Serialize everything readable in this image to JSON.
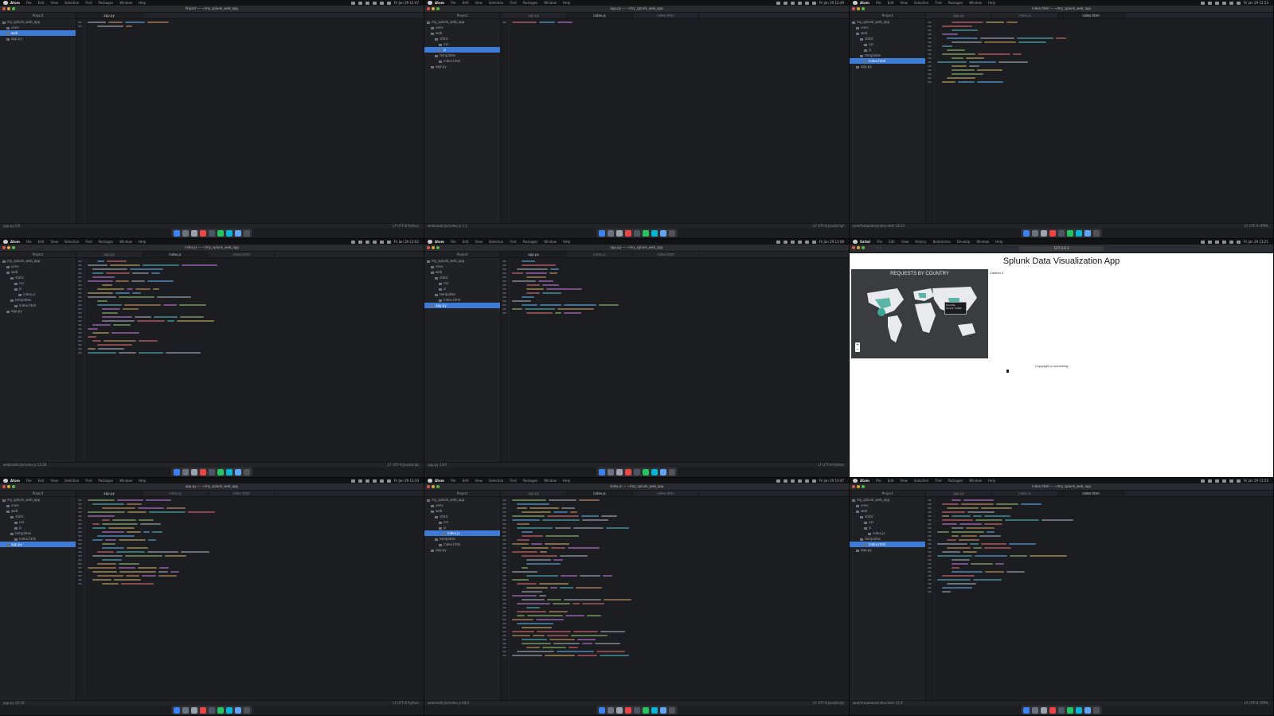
{
  "cells": [
    {
      "id": "atom-1",
      "type": "editor",
      "window_title": "Project — ~/my_splunk_web_app",
      "tabs": [
        "app.py"
      ],
      "active_tab": 0,
      "tree_head": "Project",
      "tree": [
        {
          "label": "my_splunk_web_app",
          "indent": 0
        },
        {
          "label": "venv",
          "indent": 1
        },
        {
          "label": "web",
          "indent": 1,
          "selected": true
        },
        {
          "label": "app.py",
          "indent": 1
        }
      ],
      "code_lines": 2,
      "status_left": "app.py 2:6",
      "status_right": "LF UTF-8 Python",
      "menu": [
        "Atom",
        "File",
        "Edit",
        "View",
        "Selection",
        "Find",
        "Packages",
        "Window",
        "Help"
      ],
      "clock": "Fri Jan 29 12:47"
    },
    {
      "id": "atom-2",
      "type": "editor",
      "window_title": "app.py — ~/my_splunk_web_app",
      "tabs": [
        "app.py",
        "index.js",
        "index.html"
      ],
      "active_tab": 1,
      "tree_head": "Project",
      "tree": [
        {
          "label": "my_splunk_web_app",
          "indent": 0
        },
        {
          "label": "venv",
          "indent": 1
        },
        {
          "label": "web",
          "indent": 1
        },
        {
          "label": "static",
          "indent": 2
        },
        {
          "label": "css",
          "indent": 3
        },
        {
          "label": "js",
          "indent": 3,
          "selected": true
        },
        {
          "label": "templates",
          "indent": 2
        },
        {
          "label": "index.html",
          "indent": 3
        },
        {
          "label": "app.py",
          "indent": 1
        }
      ],
      "code_lines": 1,
      "status_left": "web/static/js/index.js 1:1",
      "status_right": "LF UTF-8 JavaScript",
      "menu": [
        "Atom",
        "File",
        "Edit",
        "View",
        "Selection",
        "Find",
        "Packages",
        "Window",
        "Help"
      ],
      "clock": "Fri Jan 29 12:49"
    },
    {
      "id": "atom-3",
      "type": "editor",
      "window_title": "index.html — ~/my_splunk_web_app",
      "tabs": [
        "app.py",
        "index.js",
        "index.html"
      ],
      "active_tab": 2,
      "tree_head": "Project",
      "tree": [
        {
          "label": "my_splunk_web_app",
          "indent": 0
        },
        {
          "label": "venv",
          "indent": 1
        },
        {
          "label": "web",
          "indent": 1
        },
        {
          "label": "static",
          "indent": 2
        },
        {
          "label": "css",
          "indent": 3
        },
        {
          "label": "js",
          "indent": 3
        },
        {
          "label": "templates",
          "indent": 2
        },
        {
          "label": "index.html",
          "indent": 3,
          "selected": true
        },
        {
          "label": "app.py",
          "indent": 1
        }
      ],
      "code_lines": 16,
      "status_left": "web/templates/index.html 14:22",
      "status_right": "LF UTF-8 HTML",
      "menu": [
        "Atom",
        "File",
        "Edit",
        "View",
        "Selection",
        "Find",
        "Packages",
        "Window",
        "Help"
      ],
      "clock": "Fri Jan 29 12:53"
    },
    {
      "id": "atom-4",
      "type": "editor",
      "window_title": "index.js — ~/my_splunk_web_app",
      "tabs": [
        "app.py",
        "index.js",
        "index.html"
      ],
      "active_tab": 1,
      "tree_head": "Project",
      "tree": [
        {
          "label": "my_splunk_web_app",
          "indent": 0
        },
        {
          "label": "venv",
          "indent": 1
        },
        {
          "label": "web",
          "indent": 1
        },
        {
          "label": "static",
          "indent": 2
        },
        {
          "label": "css",
          "indent": 3
        },
        {
          "label": "js",
          "indent": 3
        },
        {
          "label": "index.js",
          "indent": 4
        },
        {
          "label": "templates",
          "indent": 2
        },
        {
          "label": "index.html",
          "indent": 3
        },
        {
          "label": "app.py",
          "indent": 1
        }
      ],
      "code_lines": 24,
      "status_left": "web/static/js/index.js 12:24",
      "status_right": "LF UTF-8 JavaScript",
      "menu": [
        "Atom",
        "File",
        "Edit",
        "View",
        "Selection",
        "Find",
        "Packages",
        "Window",
        "Help"
      ],
      "clock": "Fri Jan 29 13:02"
    },
    {
      "id": "atom-5",
      "type": "editor",
      "window_title": "app.py — ~/my_splunk_web_app",
      "tabs": [
        "app.py",
        "index.js",
        "index.html"
      ],
      "active_tab": 0,
      "tree_head": "Project",
      "tree": [
        {
          "label": "my_splunk_web_app",
          "indent": 0
        },
        {
          "label": "venv",
          "indent": 1
        },
        {
          "label": "web",
          "indent": 1
        },
        {
          "label": "static",
          "indent": 2
        },
        {
          "label": "css",
          "indent": 3
        },
        {
          "label": "js",
          "indent": 3
        },
        {
          "label": "templates",
          "indent": 2
        },
        {
          "label": "index.html",
          "indent": 3
        },
        {
          "label": "app.py",
          "indent": 1,
          "selected": true
        }
      ],
      "code_lines": 14,
      "status_left": "app.py 14:9",
      "status_right": "LF UTF-8 Python",
      "menu": [
        "Atom",
        "File",
        "Edit",
        "View",
        "Selection",
        "Find",
        "Packages",
        "Window",
        "Help"
      ],
      "clock": "Fri Jan 29 13:08"
    },
    {
      "id": "browser",
      "type": "browser",
      "url": "127.0.0.1",
      "app_title": "Splunk Data Visualization App",
      "map_title": "REQUESTS BY COUNTRY",
      "column_label": "Column 2",
      "footer": "Copyright or something...",
      "tooltip_country": "Country",
      "tooltip_value": "Count: 4,500",
      "menu": [
        "Safari",
        "File",
        "Edit",
        "View",
        "History",
        "Bookmarks",
        "Develop",
        "Window",
        "Help"
      ],
      "clock": "Fri Jan 29 13:21"
    },
    {
      "id": "atom-7",
      "type": "editor",
      "window_title": "app.py — ~/my_splunk_web_app",
      "tabs": [
        "app.py",
        "index.js",
        "index.html"
      ],
      "active_tab": 0,
      "tree_head": "Project",
      "tree": [
        {
          "label": "my_splunk_web_app",
          "indent": 0
        },
        {
          "label": "venv",
          "indent": 1
        },
        {
          "label": "web",
          "indent": 1
        },
        {
          "label": "static",
          "indent": 2
        },
        {
          "label": "css",
          "indent": 3
        },
        {
          "label": "js",
          "indent": 3
        },
        {
          "label": "templates",
          "indent": 2
        },
        {
          "label": "index.html",
          "indent": 3
        },
        {
          "label": "app.py",
          "indent": 1,
          "selected": true
        }
      ],
      "code_lines": 22,
      "status_left": "app.py 22:16",
      "status_right": "LF UTF-8 Python",
      "menu": [
        "Atom",
        "File",
        "Edit",
        "View",
        "Selection",
        "Find",
        "Packages",
        "Window",
        "Help"
      ],
      "clock": "Fri Jan 29 13:34"
    },
    {
      "id": "atom-8",
      "type": "editor",
      "window_title": "index.js — ~/my_splunk_web_app",
      "tabs": [
        "app.py",
        "index.js",
        "index.html"
      ],
      "active_tab": 1,
      "tree_head": "Project",
      "tree": [
        {
          "label": "my_splunk_web_app",
          "indent": 0
        },
        {
          "label": "venv",
          "indent": 1
        },
        {
          "label": "web",
          "indent": 1
        },
        {
          "label": "static",
          "indent": 2
        },
        {
          "label": "css",
          "indent": 3
        },
        {
          "label": "js",
          "indent": 3
        },
        {
          "label": "index.js",
          "indent": 4,
          "selected": true
        },
        {
          "label": "templates",
          "indent": 2
        },
        {
          "label": "index.html",
          "indent": 3
        },
        {
          "label": "app.py",
          "indent": 1
        }
      ],
      "code_lines": 40,
      "status_left": "web/static/js/index.js 40:2",
      "status_right": "LF UTF-8 JavaScript",
      "menu": [
        "Atom",
        "File",
        "Edit",
        "View",
        "Selection",
        "Find",
        "Packages",
        "Window",
        "Help"
      ],
      "clock": "Fri Jan 29 13:47"
    },
    {
      "id": "atom-9",
      "type": "editor",
      "window_title": "index.html — ~/my_splunk_web_app",
      "tabs": [
        "app.py",
        "index.js",
        "index.html"
      ],
      "active_tab": 2,
      "tree_head": "Project",
      "tree": [
        {
          "label": "my_splunk_web_app",
          "indent": 0
        },
        {
          "label": "venv",
          "indent": 1
        },
        {
          "label": "web",
          "indent": 1
        },
        {
          "label": "static",
          "indent": 2
        },
        {
          "label": "css",
          "indent": 3
        },
        {
          "label": "js",
          "indent": 3
        },
        {
          "label": "index.js",
          "indent": 4
        },
        {
          "label": "templates",
          "indent": 2
        },
        {
          "label": "index.html",
          "indent": 3,
          "selected": true
        },
        {
          "label": "app.py",
          "indent": 1
        }
      ],
      "code_lines": 24,
      "status_left": "web/templates/index.html 21:9",
      "status_right": "LF UTF-8 HTML",
      "menu": [
        "Atom",
        "File",
        "Edit",
        "View",
        "Selection",
        "Find",
        "Packages",
        "Window",
        "Help"
      ],
      "clock": "Fri Jan 29 13:56"
    }
  ],
  "colors": {
    "code_palette": [
      "#d1b36c",
      "#c678dd",
      "#98c379",
      "#61afef",
      "#e06c75",
      "#abb2bf",
      "#56b6c2",
      "#d19a66"
    ],
    "dock_palette": [
      "#3b82f6",
      "#6b7280",
      "#9ca3af",
      "#ef4444",
      "#4b5563",
      "#22c55e",
      "#06b6d4",
      "#60a5fa",
      "#52525b"
    ],
    "selection": "#3d7bd6",
    "map_land": "#e8eaee",
    "map_highlight": "#39a894"
  }
}
